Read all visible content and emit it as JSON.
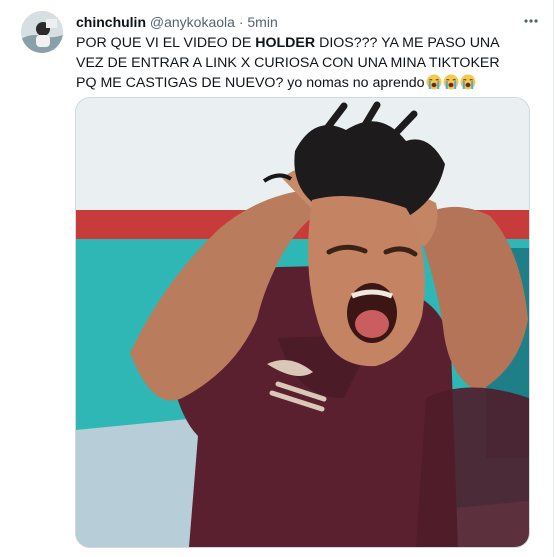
{
  "tweet": {
    "display_name": "chinchulin",
    "handle": "@anykokaola",
    "separator": "·",
    "timestamp": "5min",
    "text_before_bold": "POR QUE VI EL VIDEO DE ",
    "text_bold": "HOLDER",
    "text_after_bold": " DIOS??? YA ME PASO UNA VEZ DE ENTRAR A LINK X CURIOSA CON UNA MINA TIKTOKER PQ ME CASTIGAS DE NUEVO? yo nomas no aprendo",
    "emojis": [
      "loudly-crying-face",
      "loudly-crying-face",
      "loudly-crying-face"
    ],
    "media_description_icon": "photo"
  },
  "colors": {
    "primary_text": "#0f1419",
    "secondary_text": "#536471",
    "border": "#cfd9de",
    "wall_turquoise": "#2eb7b5",
    "wall_red_stripe": "#c83b3b",
    "shirt_maroon": "#5a2030"
  }
}
